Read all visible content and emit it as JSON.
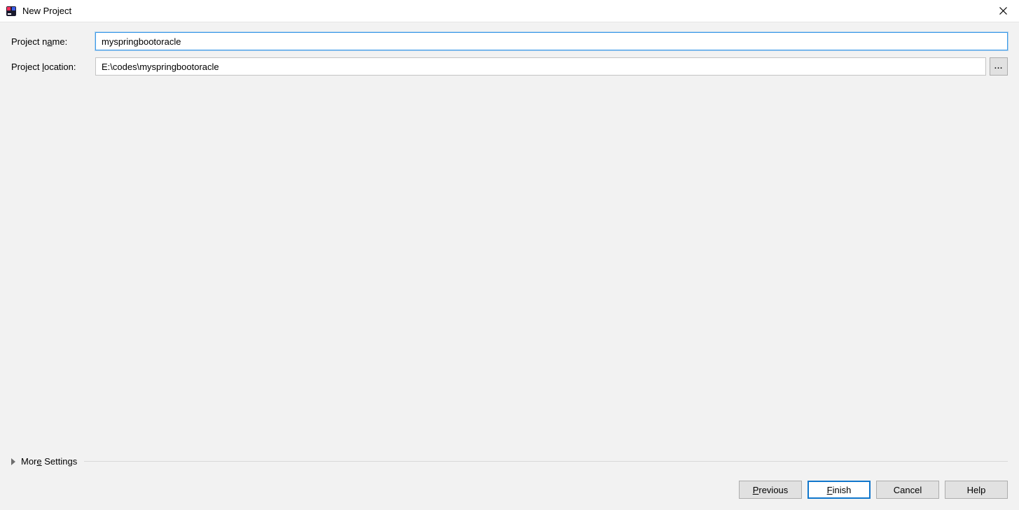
{
  "window": {
    "title": "New Project"
  },
  "form": {
    "project_name_label_pre": "Project n",
    "project_name_label_mnem": "a",
    "project_name_label_post": "me:",
    "project_name_value": "myspringbootoracle",
    "project_location_label_pre": "Project ",
    "project_location_label_mnem": "l",
    "project_location_label_post": "ocation:",
    "project_location_value": "E:\\codes\\myspringbootoracle",
    "browse_label": "..."
  },
  "more_settings": {
    "label_pre": "Mor",
    "label_mnem": "e",
    "label_post": " Settings"
  },
  "buttons": {
    "previous_pre": "",
    "previous_mnem": "P",
    "previous_post": "revious",
    "finish_pre": "",
    "finish_mnem": "F",
    "finish_post": "inish",
    "cancel": "Cancel",
    "help": "Help"
  }
}
